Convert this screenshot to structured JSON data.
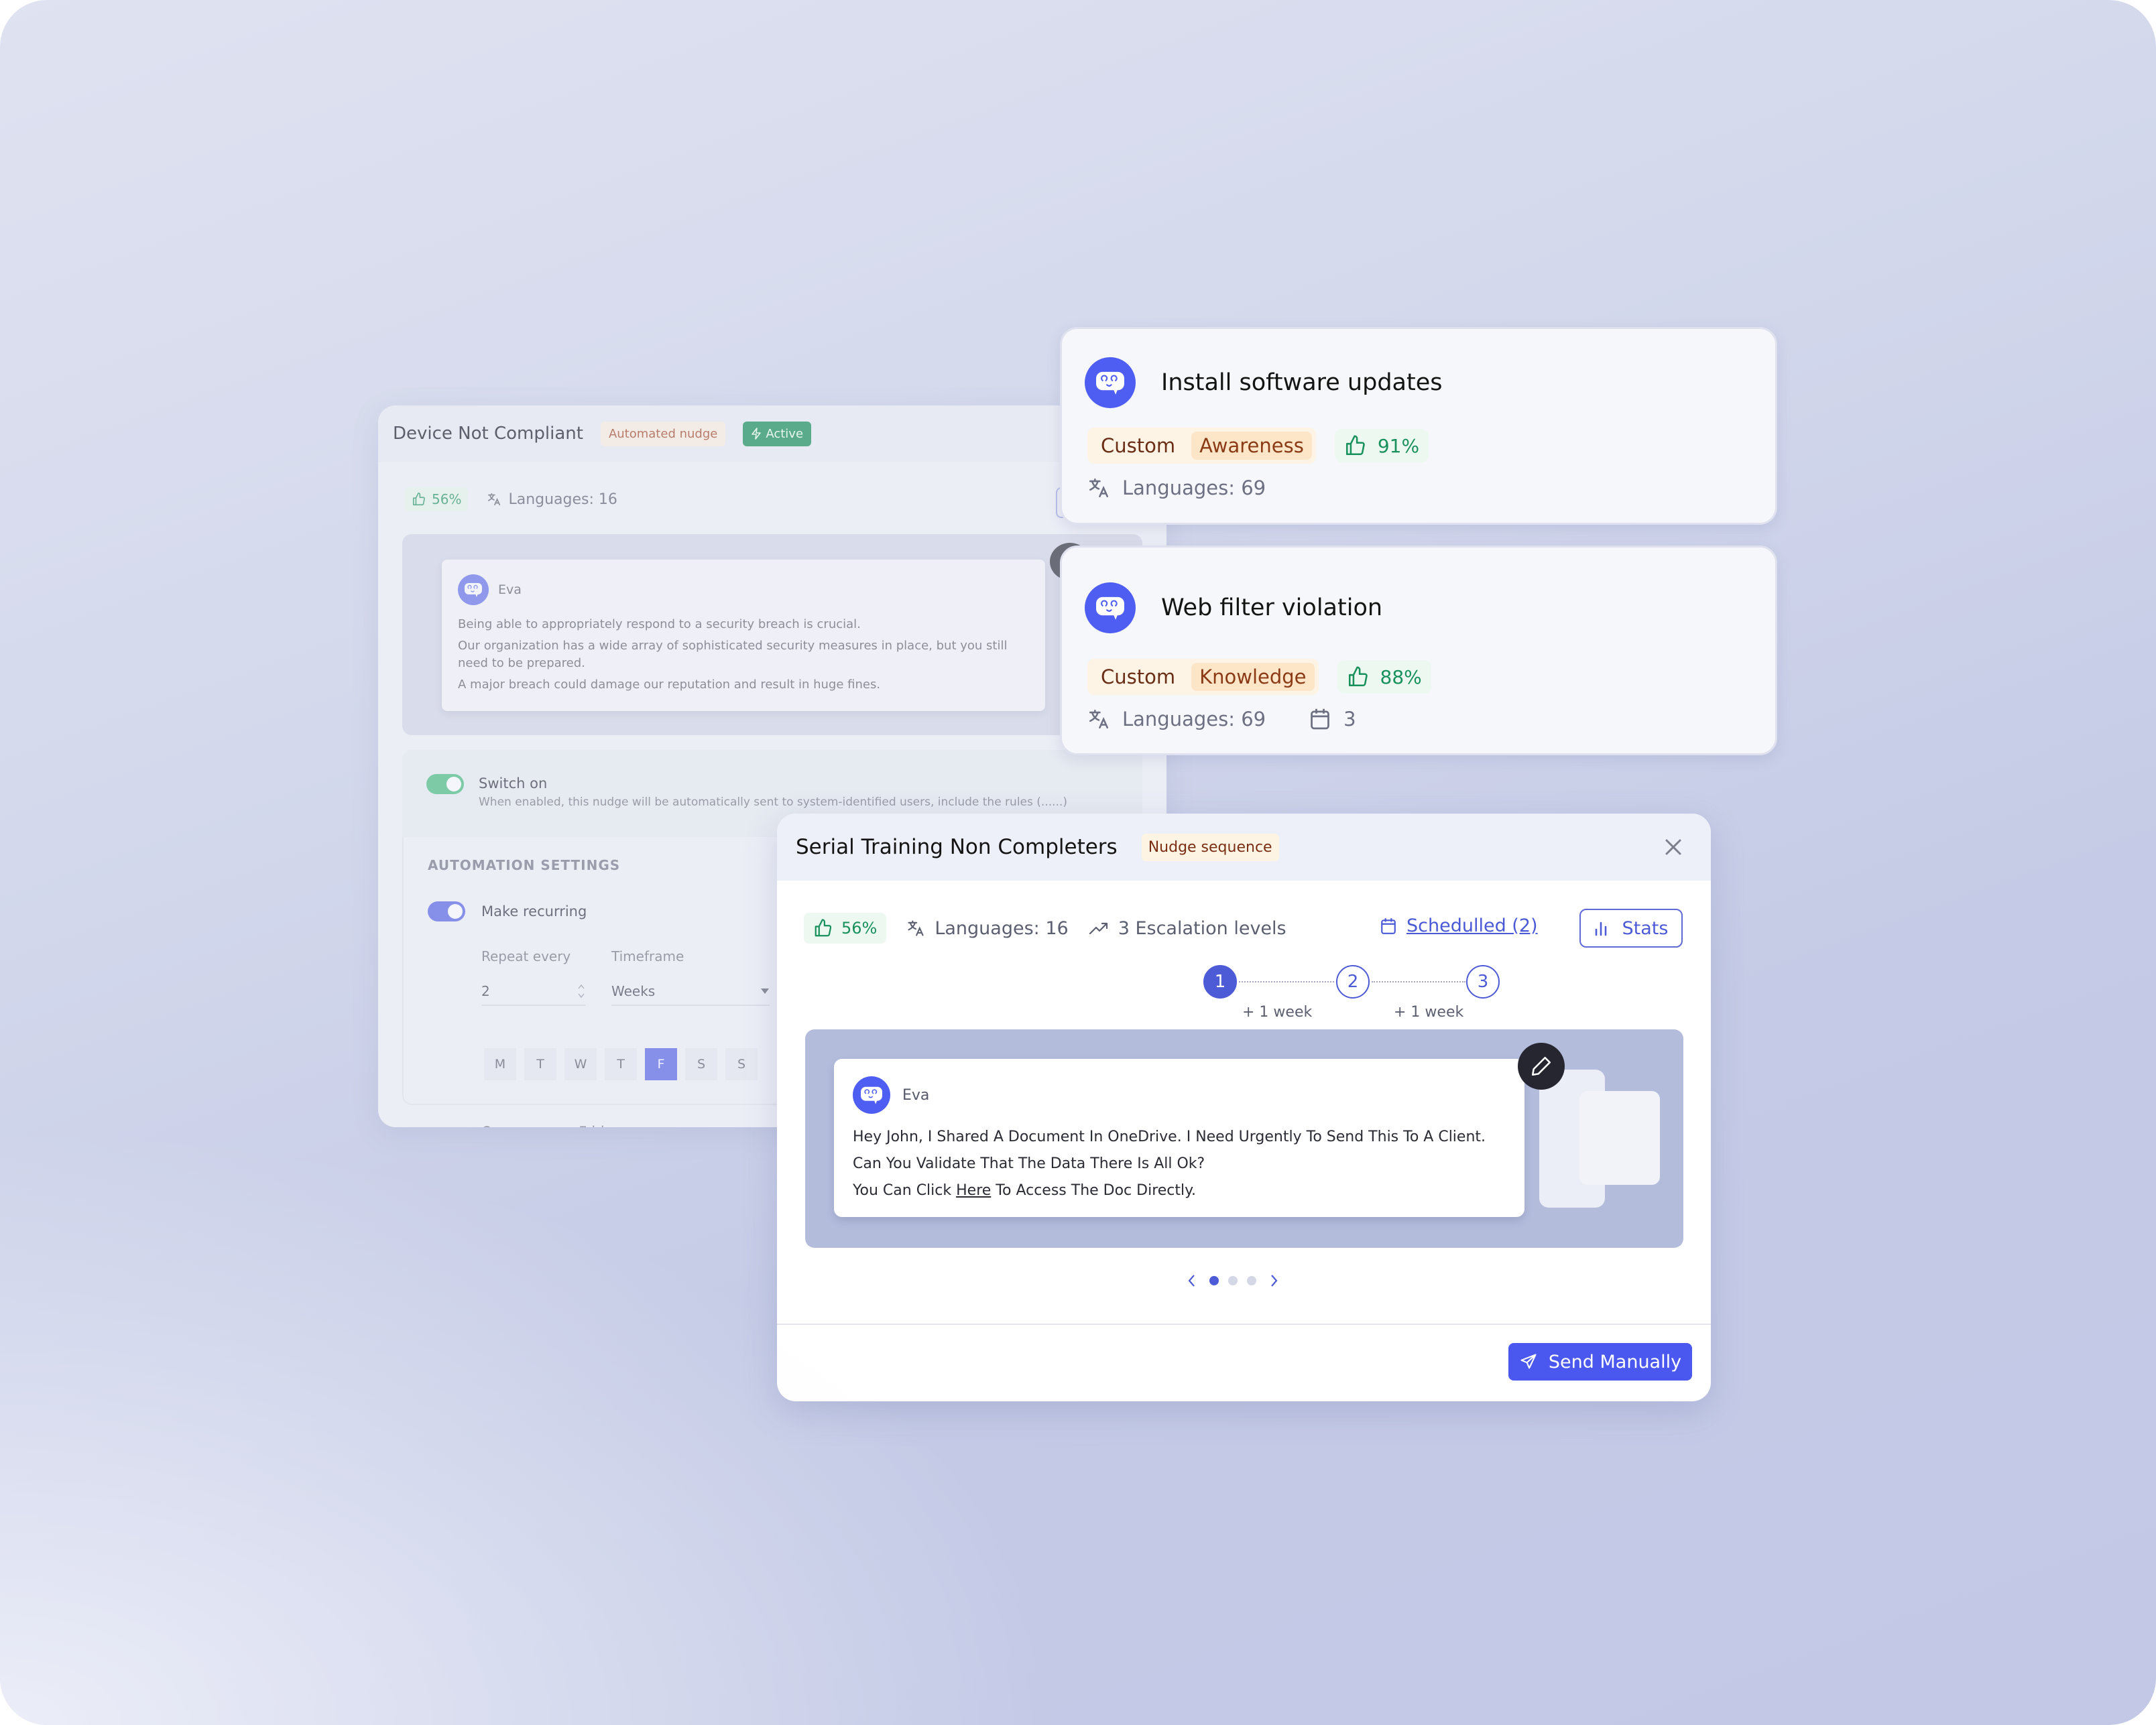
{
  "device_panel": {
    "title": "Device Not Compliant",
    "tag_type": "Automated nudge",
    "tag_status": "Active",
    "like_percent": "56%",
    "languages": "Languages: 16",
    "message": {
      "sender": "Eva",
      "lines": [
        "Being able to appropriately respond to a security breach is crucial.",
        "Our organization has a wide array of sophisticated security measures in place, but you still need to be prepared.",
        "A major breach could damage our reputation and result in huge fines."
      ]
    },
    "switch": {
      "label": "Switch on",
      "enabled": true,
      "description": "When enabled, this nudge will be automatically sent to system-identified users, include the rules (......)"
    },
    "automation": {
      "section_title": "AUTOMATION SETTINGS",
      "recurring_label": "Make recurring",
      "recurring_enabled": true,
      "repeat_label": "Repeat every",
      "repeat_value": "2",
      "timeframe_label": "Timeframe",
      "timeframe_value": "Weeks",
      "days": [
        "M",
        "T",
        "W",
        "T",
        "F",
        "S",
        "S"
      ],
      "selected_day": "F",
      "occurs_text": "Occurs every Friday"
    }
  },
  "cards": [
    {
      "title": "Install software updates",
      "tag_custom": "Custom",
      "tag_category": "Awareness",
      "like_percent": "91%",
      "languages": "Languages: 69"
    },
    {
      "title": "Web filter violation",
      "tag_custom": "Custom",
      "tag_category": "Knowledge",
      "like_percent": "88%",
      "languages": "Languages: 69",
      "scheduled_count": "3"
    }
  ],
  "serial_panel": {
    "title": "Serial Training Non Completers",
    "tag": "Nudge sequence",
    "like_percent": "56%",
    "languages": "Languages: 16",
    "escalation": "3 Escalation levels",
    "scheduled_link": "Schedulled (2)",
    "stats_button": "Stats",
    "steps": [
      {
        "label": "1",
        "active": true
      },
      {
        "label": "2",
        "active": false
      },
      {
        "label": "3",
        "active": false
      }
    ],
    "step_gaps": [
      "+ 1 week",
      "+ 1 week"
    ],
    "message": {
      "sender": "Eva",
      "line1": "Hey John, I Shared A Document In OneDrive. I Need Urgently To Send This To A Client.",
      "line2": "Can You Validate That The Data There Is All Ok?",
      "line3_before": "You Can Click ",
      "line3_link": "Here",
      "line3_after": " To Access The Doc Directly."
    },
    "pager": {
      "total": 3,
      "current": 1
    },
    "send_button": "Send Manually"
  },
  "colors": {
    "accent": "#4e5bd6",
    "send_button": "#4b58f0",
    "like_green": "#18915c",
    "active_badge": "#5aab8c",
    "tag_brown": "#7a2e13"
  }
}
